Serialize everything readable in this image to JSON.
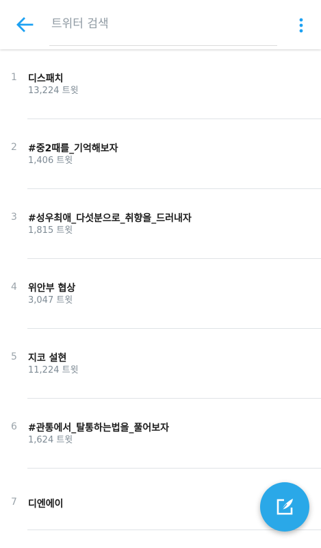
{
  "colors": {
    "accent": "#1da1f2",
    "fab": "#2aa8e8",
    "title_text": "#1b1b1b",
    "meta_text": "#7d8a94"
  },
  "header": {
    "back_icon": "arrow-left-icon",
    "search_placeholder": "트위터 검색",
    "search_value": "",
    "more_icon": "more-vertical-icon"
  },
  "trends": [
    {
      "rank": "1",
      "title": "디스패치",
      "count": "13,224 트윗"
    },
    {
      "rank": "2",
      "title": "#중2때를_기억해보자",
      "count": "1,406 트윗"
    },
    {
      "rank": "3",
      "title": "#성우최애_다섯분으로_취향을_드러내자",
      "count": "1,815 트윗"
    },
    {
      "rank": "4",
      "title": "위안부 협상",
      "count": "3,047 트윗"
    },
    {
      "rank": "5",
      "title": "지코 설현",
      "count": "11,224 트윗"
    },
    {
      "rank": "6",
      "title": "#관통에서_탈통하는법을_풀어보자",
      "count": "1,624 트윗"
    },
    {
      "rank": "7",
      "title": "디엔에이",
      "count": ""
    }
  ],
  "fab": {
    "icon": "compose-tweet-icon"
  }
}
